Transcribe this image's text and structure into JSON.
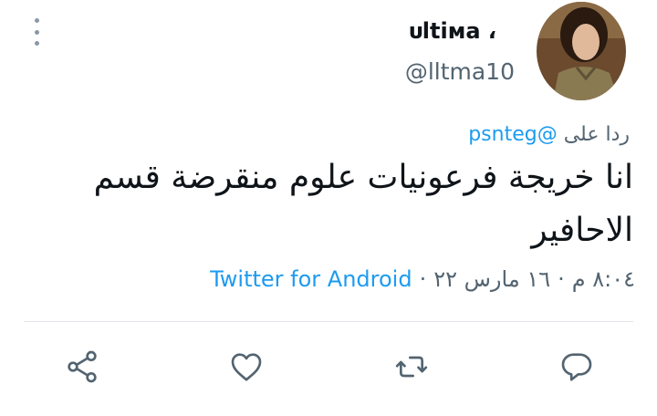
{
  "author": {
    "display_name": "ᴜltiмa ،",
    "handle": "@lltma10"
  },
  "reply": {
    "prefix": "ردا على",
    "mention": "@psnteg"
  },
  "tweet": {
    "text": "انا خريجة فرعونيات علوم منقرضة قسم الاحافير"
  },
  "meta": {
    "time": "٨:٠٤ م",
    "date": "١٦ مارس ٢٢",
    "client": "Twitter for Android"
  },
  "actions": [
    "reply-icon",
    "retweet-icon",
    "like-icon",
    "share-icon"
  ],
  "colors": {
    "link": "#1d9bf0",
    "text": "#0f1419",
    "muted": "#536471"
  }
}
